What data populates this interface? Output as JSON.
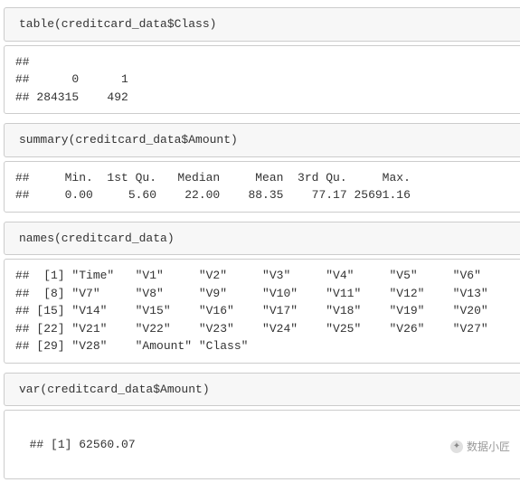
{
  "cells": {
    "table_code": "table(creditcard_data$Class)",
    "table_out": "##\n##      0      1\n## 284315    492",
    "summary_code": "summary(creditcard_data$Amount)",
    "summary_out": "##     Min.  1st Qu.   Median     Mean  3rd Qu.     Max.\n##     0.00     5.60    22.00    88.35    77.17 25691.16",
    "names_code": "names(creditcard_data)",
    "names_out": "##  [1] \"Time\"   \"V1\"     \"V2\"     \"V3\"     \"V4\"     \"V5\"     \"V6\"\n##  [8] \"V7\"     \"V8\"     \"V9\"     \"V10\"    \"V11\"    \"V12\"    \"V13\"\n## [15] \"V14\"    \"V15\"    \"V16\"    \"V17\"    \"V18\"    \"V19\"    \"V20\"\n## [22] \"V21\"    \"V22\"    \"V23\"    \"V24\"    \"V25\"    \"V26\"    \"V27\"\n## [29] \"V28\"    \"Amount\" \"Class\"",
    "var_code": "var(creditcard_data$Amount)",
    "var_out": "## [1] 62560.07"
  },
  "watermark": "数据小匠",
  "chart_data": {
    "type": "table",
    "class_table": {
      "0": 284315,
      "1": 492
    },
    "amount_summary": {
      "Min.": 0.0,
      "1st Qu.": 5.6,
      "Median": 22.0,
      "Mean": 88.35,
      "3rd Qu.": 77.17,
      "Max.": 25691.16
    },
    "column_names": [
      "Time",
      "V1",
      "V2",
      "V3",
      "V4",
      "V5",
      "V6",
      "V7",
      "V8",
      "V9",
      "V10",
      "V11",
      "V12",
      "V13",
      "V14",
      "V15",
      "V16",
      "V17",
      "V18",
      "V19",
      "V20",
      "V21",
      "V22",
      "V23",
      "V24",
      "V25",
      "V26",
      "V27",
      "V28",
      "Amount",
      "Class"
    ],
    "amount_variance": 62560.07
  }
}
